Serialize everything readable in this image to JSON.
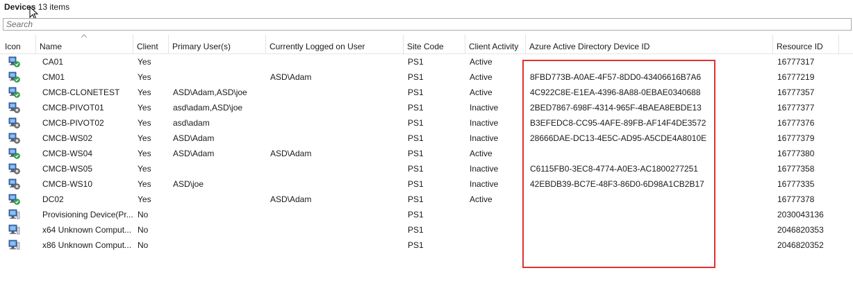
{
  "window": {
    "title": "Devices",
    "item_count": "13 items"
  },
  "search": {
    "placeholder": "Search",
    "value": ""
  },
  "columns": [
    "Icon",
    "Name",
    "Client",
    "Primary User(s)",
    "Currently Logged on User",
    "Site Code",
    "Client Activity",
    "Azure Active Directory Device ID",
    "Resource ID"
  ],
  "sort_column": "Name",
  "highlight_column": "Azure Active Directory Device ID",
  "colors": {
    "highlight_border": "#e03030",
    "grid_line": "#e3e3e3"
  },
  "rows": [
    {
      "icon": "managed-device-icon",
      "name": "CA01",
      "client": "Yes",
      "primary_users": "",
      "logged_on": "",
      "site_code": "PS1",
      "activity": "Active",
      "aad_id": "",
      "resource_id": "16777317"
    },
    {
      "icon": "managed-device-icon",
      "name": "CM01",
      "client": "Yes",
      "primary_users": "",
      "logged_on": "ASD\\Adam",
      "site_code": "PS1",
      "activity": "Active",
      "aad_id": "8FBD773B-A0AE-4F57-8DD0-43406616B7A6",
      "resource_id": "16777219"
    },
    {
      "icon": "managed-device-icon",
      "name": "CMCB-CLONETEST",
      "client": "Yes",
      "primary_users": "ASD\\Adam,ASD\\joe",
      "logged_on": "",
      "site_code": "PS1",
      "activity": "Active",
      "aad_id": "4C922C8E-E1EA-4396-8A88-0EBAE0340688",
      "resource_id": "16777357"
    },
    {
      "icon": "inactive-device-icon",
      "name": "CMCB-PIVOT01",
      "client": "Yes",
      "primary_users": "asd\\adam,ASD\\joe",
      "logged_on": "",
      "site_code": "PS1",
      "activity": "Inactive",
      "aad_id": "2BED7867-698F-4314-965F-4BAEA8EBDE13",
      "resource_id": "16777377"
    },
    {
      "icon": "inactive-device-icon",
      "name": "CMCB-PIVOT02",
      "client": "Yes",
      "primary_users": "asd\\adam",
      "logged_on": "",
      "site_code": "PS1",
      "activity": "Inactive",
      "aad_id": "B3EFEDC8-CC95-4AFE-89FB-AF14F4DE3572",
      "resource_id": "16777376"
    },
    {
      "icon": "inactive-device-icon",
      "name": "CMCB-WS02",
      "client": "Yes",
      "primary_users": "ASD\\Adam",
      "logged_on": "",
      "site_code": "PS1",
      "activity": "Inactive",
      "aad_id": "28666DAE-DC13-4E5C-AD95-A5CDE4A8010E",
      "resource_id": "16777379"
    },
    {
      "icon": "managed-device-icon",
      "name": "CMCB-WS04",
      "client": "Yes",
      "primary_users": "ASD\\Adam",
      "logged_on": "ASD\\Adam",
      "site_code": "PS1",
      "activity": "Active",
      "aad_id": "",
      "resource_id": "16777380"
    },
    {
      "icon": "inactive-device-icon",
      "name": "CMCB-WS05",
      "client": "Yes",
      "primary_users": "",
      "logged_on": "",
      "site_code": "PS1",
      "activity": "Inactive",
      "aad_id": "C6115FB0-3EC8-4774-A0E3-AC1800277251",
      "resource_id": "16777358"
    },
    {
      "icon": "inactive-device-icon",
      "name": "CMCB-WS10",
      "client": "Yes",
      "primary_users": "ASD\\joe",
      "logged_on": "",
      "site_code": "PS1",
      "activity": "Inactive",
      "aad_id": "42EBDB39-BC7E-48F3-86D0-6D98A1CB2B17",
      "resource_id": "16777335"
    },
    {
      "icon": "managed-device-icon",
      "name": "DC02",
      "client": "Yes",
      "primary_users": "",
      "logged_on": "ASD\\Adam",
      "site_code": "PS1",
      "activity": "Active",
      "aad_id": "",
      "resource_id": "16777378"
    },
    {
      "icon": "unmanaged-device-icon",
      "name": "Provisioning Device(Pr...",
      "client": "No",
      "primary_users": "",
      "logged_on": "",
      "site_code": "PS1",
      "activity": "",
      "aad_id": "",
      "resource_id": "2030043136"
    },
    {
      "icon": "unmanaged-device-icon",
      "name": "x64 Unknown Comput...",
      "client": "No",
      "primary_users": "",
      "logged_on": "",
      "site_code": "PS1",
      "activity": "",
      "aad_id": "",
      "resource_id": "2046820353"
    },
    {
      "icon": "unmanaged-device-icon",
      "name": "x86 Unknown Comput...",
      "client": "No",
      "primary_users": "",
      "logged_on": "",
      "site_code": "PS1",
      "activity": "",
      "aad_id": "",
      "resource_id": "2046820352"
    }
  ]
}
